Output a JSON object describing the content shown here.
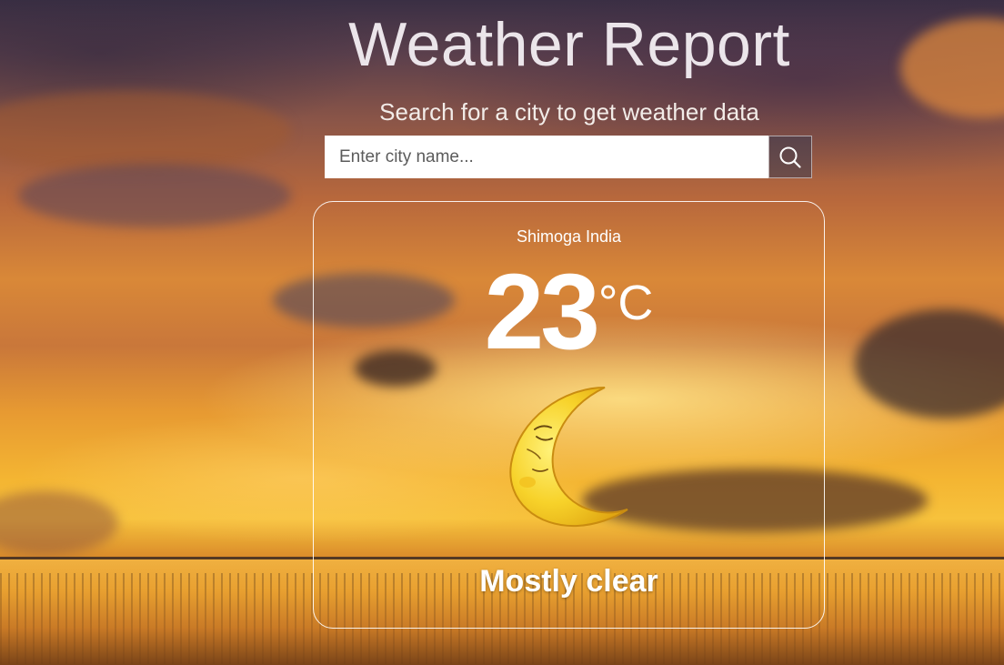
{
  "header": {
    "title": "Weather Report",
    "subtitle": "Search for a city to get weather data"
  },
  "search": {
    "placeholder": "Enter city name...",
    "value": "",
    "button_icon": "search-icon"
  },
  "weather": {
    "location": "Shimoga India",
    "temperature": "23",
    "unit": "°C",
    "condition": "Mostly clear",
    "icon": "sleeping-crescent-moon-icon"
  },
  "colors": {
    "text": "#ffffff",
    "card_border": "#ffffff",
    "moon": "#f5d020"
  }
}
